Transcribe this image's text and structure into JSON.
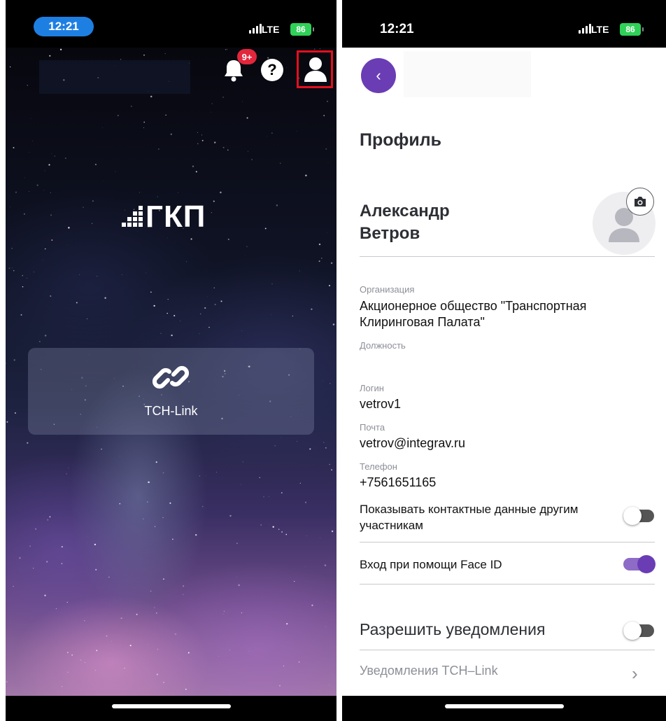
{
  "left": {
    "status": {
      "time": "12:21",
      "network": "LTE",
      "battery": "86"
    },
    "header": {
      "badge": "9+",
      "help_glyph": "?"
    },
    "logo": {
      "text": "ГКП"
    },
    "tile": {
      "label": "TCH-Link"
    }
  },
  "right": {
    "status": {
      "time": "12:21",
      "network": "LTE",
      "battery": "86"
    },
    "header": {
      "back_glyph": "‹"
    },
    "title": "Профиль",
    "user": {
      "first_name": "Александр",
      "last_name": "Ветров"
    },
    "fields": [
      {
        "label": "Организация",
        "value": "Акционерное общество \"Транспортная Клиринговая Палата\""
      },
      {
        "label": "Должность",
        "value": ""
      },
      {
        "label": "Логин",
        "value": "vetrov1"
      },
      {
        "label": "Почта",
        "value": "vetrov@integrav.ru"
      },
      {
        "label": "Телефон",
        "value": "+7561651165"
      }
    ],
    "toggles": [
      {
        "label": "Показывать контактные данные другим участникам",
        "on": false
      },
      {
        "label": "Вход при помощи Face ID",
        "on": true
      }
    ],
    "notifications": {
      "label": "Разрешить уведомления",
      "on": false,
      "sub_label": "Уведомления TCH–Link",
      "chevron": "›"
    }
  },
  "colors": {
    "accent": "#6a3db5",
    "badge": "#e2263b",
    "highlight": "#e3101e",
    "time_pill": "#1e7fe3",
    "battery": "#2fd158"
  },
  "icons": [
    "bell-icon",
    "help-icon",
    "profile-icon",
    "link-icon",
    "camera-icon",
    "back-icon",
    "chevron-right-icon",
    "avatar-placeholder-icon"
  ]
}
